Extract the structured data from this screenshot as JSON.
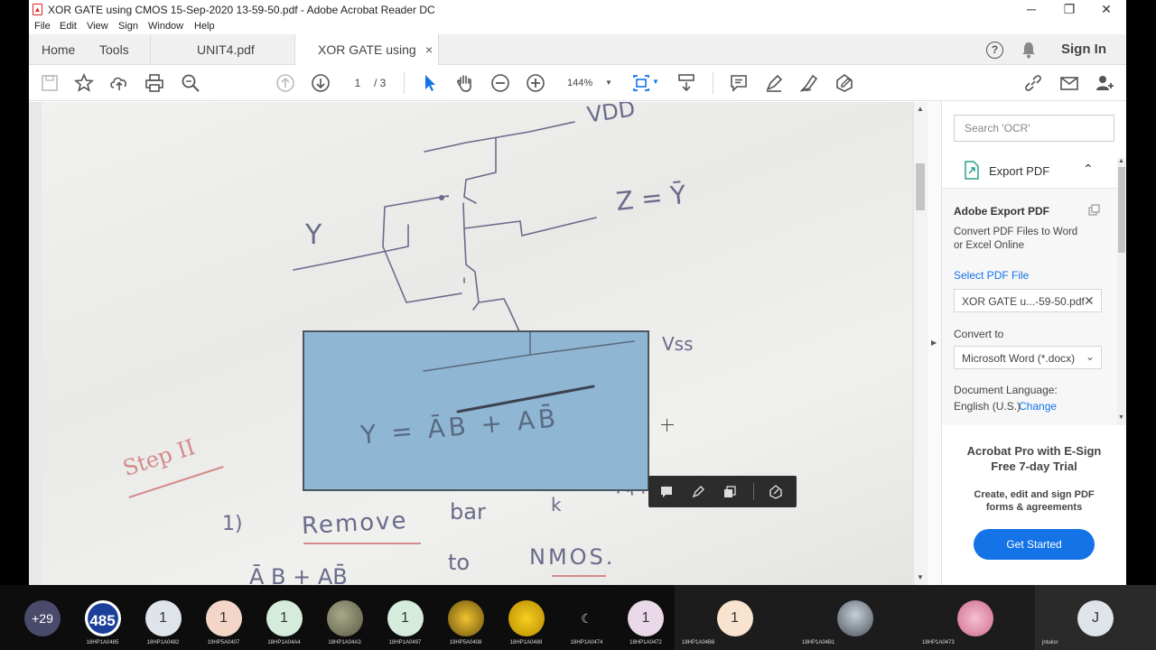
{
  "window": {
    "title": "XOR GATE using CMOS 15-Sep-2020 13-59-50.pdf - Adobe Acrobat Reader DC",
    "minimize": "─",
    "maximize": "❐",
    "close": "✕"
  },
  "menu": [
    "File",
    "Edit",
    "View",
    "Sign",
    "Window",
    "Help"
  ],
  "tabs": {
    "home": "Home",
    "tools": "Tools",
    "doc1": "UNIT4.pdf",
    "doc2": "XOR GATE using C...",
    "doc2_close": "×",
    "signin": "Sign In"
  },
  "toolbar": {
    "page_current": "1",
    "page_total": "/ 3",
    "zoom": "144%"
  },
  "handwriting": {
    "vdd": "VDD",
    "z_eq": "Z = Ȳ",
    "y_label": "Y",
    "vss": "Vss",
    "equation": "Y = ĀB + AB̄",
    "step": "Step II",
    "item_num": "1)",
    "remove": "Remove",
    "bar": "bar",
    "k": "k",
    "to": "to",
    "nmos": "NMOS.",
    "partial": "Ā B + AB̄",
    "app": "App"
  },
  "panel": {
    "search_placeholder": "Search 'OCR'",
    "export_title": "Export PDF",
    "adobe_export": "Adobe Export PDF",
    "convert_line1": "Convert PDF Files to Word",
    "convert_line2": "or Excel Online",
    "select_pdf": "Select PDF File",
    "file_name": "XOR GATE u...-59-50.pdf",
    "convert_to": "Convert to",
    "format": "Microsoft Word (*.docx)",
    "doc_language": "Document Language:",
    "language": "English (U.S.)",
    "change": "Change",
    "promo_line1": "Acrobat Pro with E-Sign",
    "promo_line2": "Free 7-day Trial",
    "promo_desc1": "Create, edit and sign PDF",
    "promo_desc2": "forms & agreements",
    "get_started": "Get Started"
  },
  "participants": [
    {
      "initial": "+29",
      "name": "",
      "color": "#4a4a6a"
    },
    {
      "initial": "485",
      "name": "18HP1A0485",
      "color": "#ffffff"
    },
    {
      "initial": "1",
      "name": "18HP1A0482",
      "color": "#dfe3ea"
    },
    {
      "initial": "1",
      "name": "19HP5A0407",
      "color": "#f3d6c8"
    },
    {
      "initial": "1",
      "name": "18HP1A04A4",
      "color": "#d5ecdc"
    },
    {
      "initial": "",
      "name": "18HP1A04A3",
      "color": "#7a7a5a"
    },
    {
      "initial": "1",
      "name": "18HP1A0497",
      "color": "#d5ecdc"
    },
    {
      "initial": "",
      "name": "19HP5A0408",
      "color": "#c9a21a"
    },
    {
      "initial": "",
      "name": "18HP1A0488",
      "color": "#e8c020"
    },
    {
      "initial": "",
      "name": "18HP1A0474",
      "color": "#111111"
    },
    {
      "initial": "1",
      "name": "18HP1A0472",
      "color": "#ead9e8"
    },
    {
      "initial": "1",
      "name": "18HP1A04B6",
      "color": "#f7e3cf"
    },
    {
      "initial": "",
      "name": "18HP1A04B1",
      "color": "#9aa7b0"
    },
    {
      "initial": "",
      "name": "18HP1A0473",
      "color": "#e9a0b8"
    },
    {
      "initial": "J",
      "name": "jntuksr",
      "color": "#dfe3ea"
    }
  ]
}
